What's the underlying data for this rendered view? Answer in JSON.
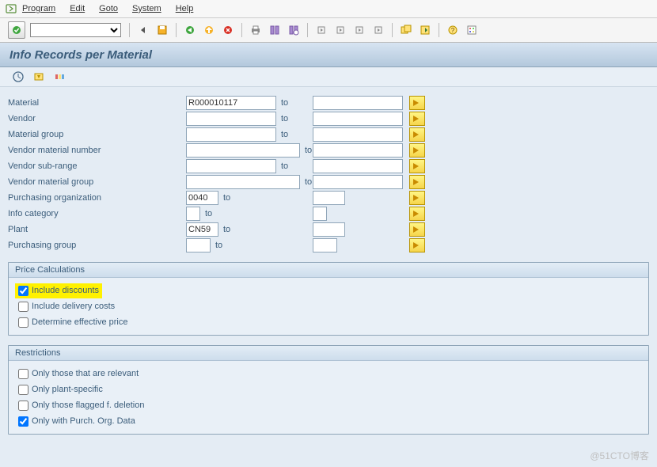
{
  "menu": {
    "items": [
      "Program",
      "Edit",
      "Goto",
      "System",
      "Help"
    ]
  },
  "title": "Info Records per Material",
  "fields": {
    "material": {
      "label": "Material",
      "from": "R000010117",
      "to": ""
    },
    "vendor": {
      "label": "Vendor",
      "from": "",
      "to": ""
    },
    "matgroup": {
      "label": "Material group",
      "from": "",
      "to": ""
    },
    "venmatnum": {
      "label": "Vendor material number",
      "from": "",
      "to": ""
    },
    "vensubrange": {
      "label": "Vendor sub-range",
      "from": "",
      "to": ""
    },
    "venmatgroup": {
      "label": "Vendor material group",
      "from": "",
      "to": ""
    },
    "purchorg": {
      "label": "Purchasing organization",
      "from": "0040",
      "to": ""
    },
    "infocat": {
      "label": "Info category",
      "from": "",
      "to": ""
    },
    "plant": {
      "label": "Plant",
      "from": "CN59",
      "to": ""
    },
    "purchgroup": {
      "label": "Purchasing group",
      "from": "",
      "to": ""
    }
  },
  "to_label": "to",
  "groups": {
    "price": {
      "title": "Price Calculations",
      "inc_discounts": "Include discounts",
      "inc_delivery": "Include delivery costs",
      "det_eff": "Determine effective price"
    },
    "restrict": {
      "title": "Restrictions",
      "only_relevant": "Only those that are relevant",
      "only_plant": "Only plant-specific",
      "only_flagged": "Only those flagged f. deletion",
      "only_purchorg": "Only with Purch. Org. Data"
    }
  },
  "checkbox_state": {
    "inc_discounts": true,
    "inc_delivery": false,
    "det_eff": false,
    "only_relevant": false,
    "only_plant": false,
    "only_flagged": false,
    "only_purchorg": true
  },
  "watermark": "@51CTO博客"
}
